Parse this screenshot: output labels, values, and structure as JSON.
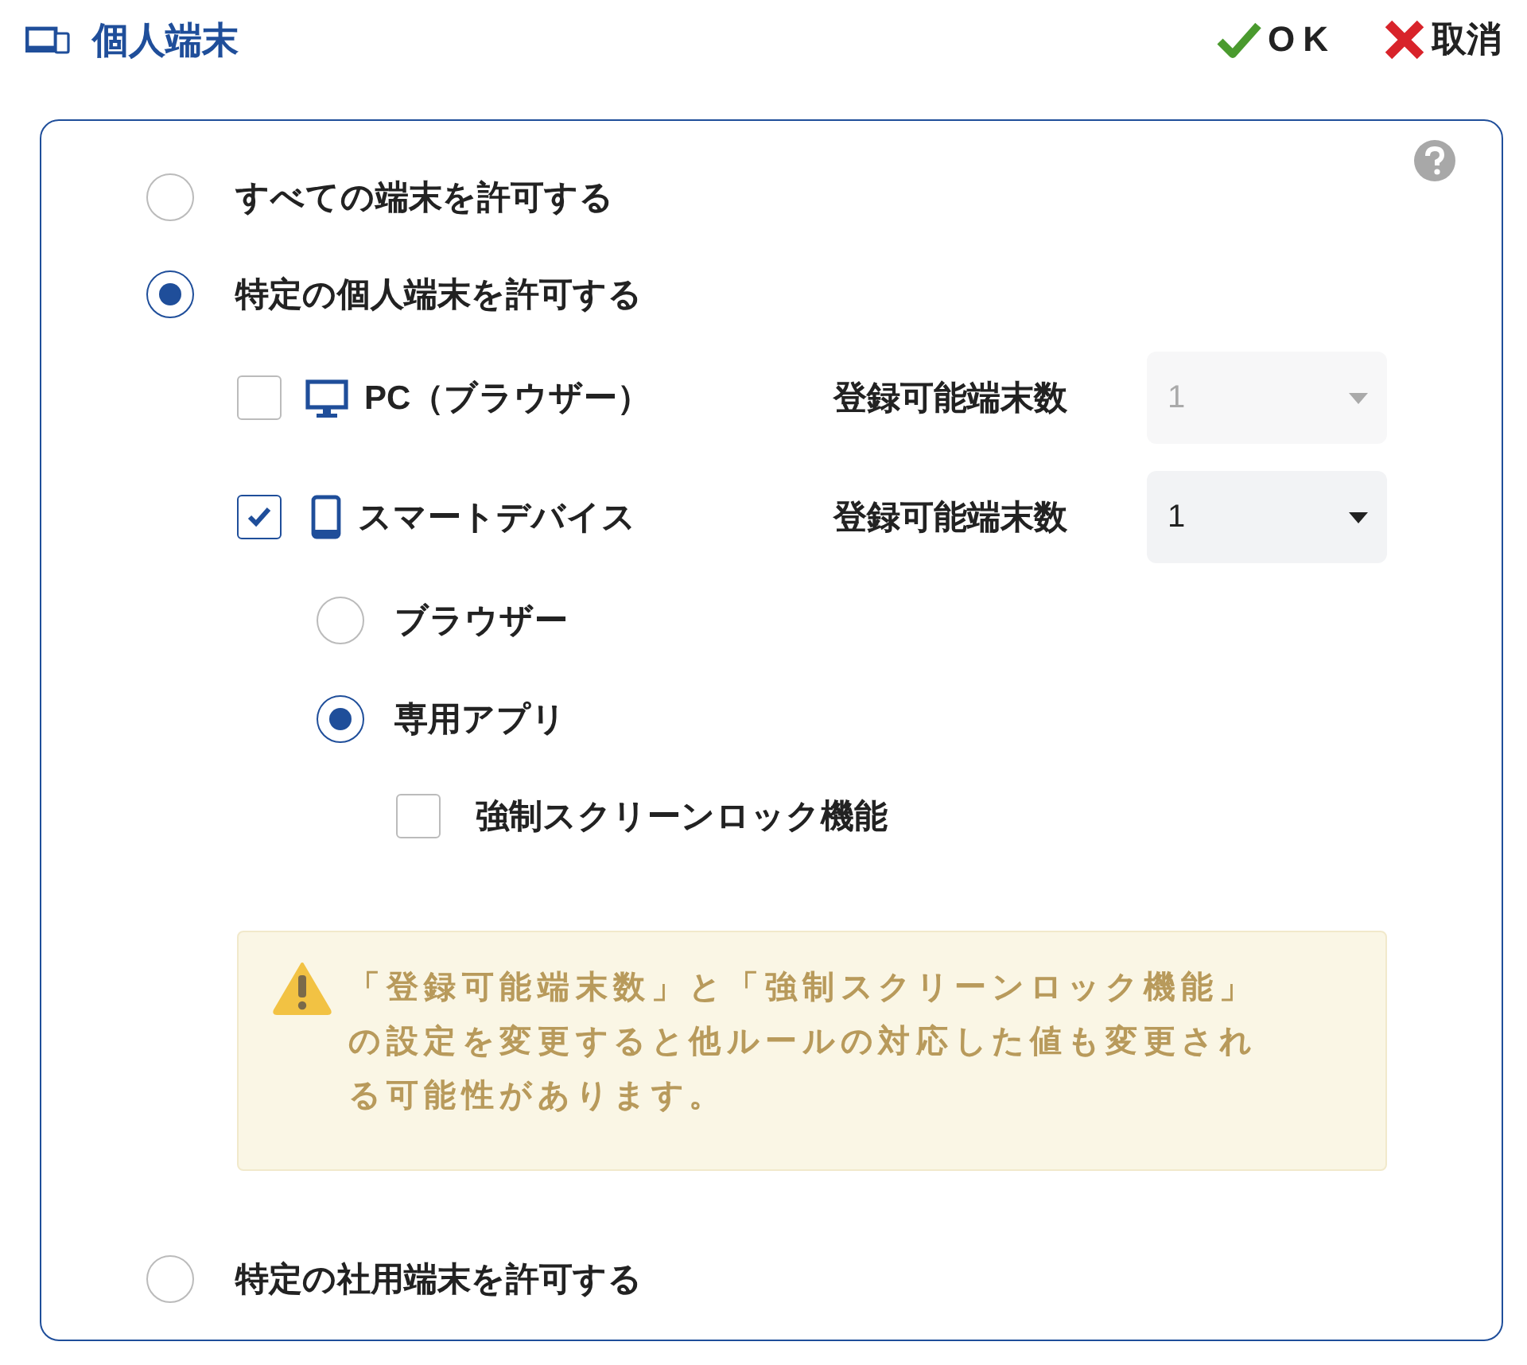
{
  "header": {
    "title": "個人端末",
    "ok": "OK",
    "cancel": "取消"
  },
  "options": [
    {
      "label": "すべての端末を許可する",
      "selected": false
    },
    {
      "label": "特定の個人端末を許可する",
      "selected": true,
      "devices": [
        {
          "kind": "pc",
          "label": "PC（ブラウザー）",
          "checked": false,
          "count_label": "登録可能端末数",
          "count": "1",
          "disabled": true
        },
        {
          "kind": "smart",
          "label": "スマートデバイス",
          "checked": true,
          "count_label": "登録可能端末数",
          "count": "1",
          "disabled": false,
          "modes": [
            {
              "label": "ブラウザー",
              "selected": false
            },
            {
              "label": "専用アプリ",
              "selected": true,
              "options": [
                {
                  "label": "強制スクリーンロック機能",
                  "checked": false
                }
              ]
            }
          ]
        }
      ],
      "warning": "「登録可能端末数」と「強制スクリーンロック機能」の設定を変更すると他ルールの対応した値も変更される可能性があります。"
    },
    {
      "label": "特定の社用端末を許可する",
      "selected": false
    }
  ]
}
